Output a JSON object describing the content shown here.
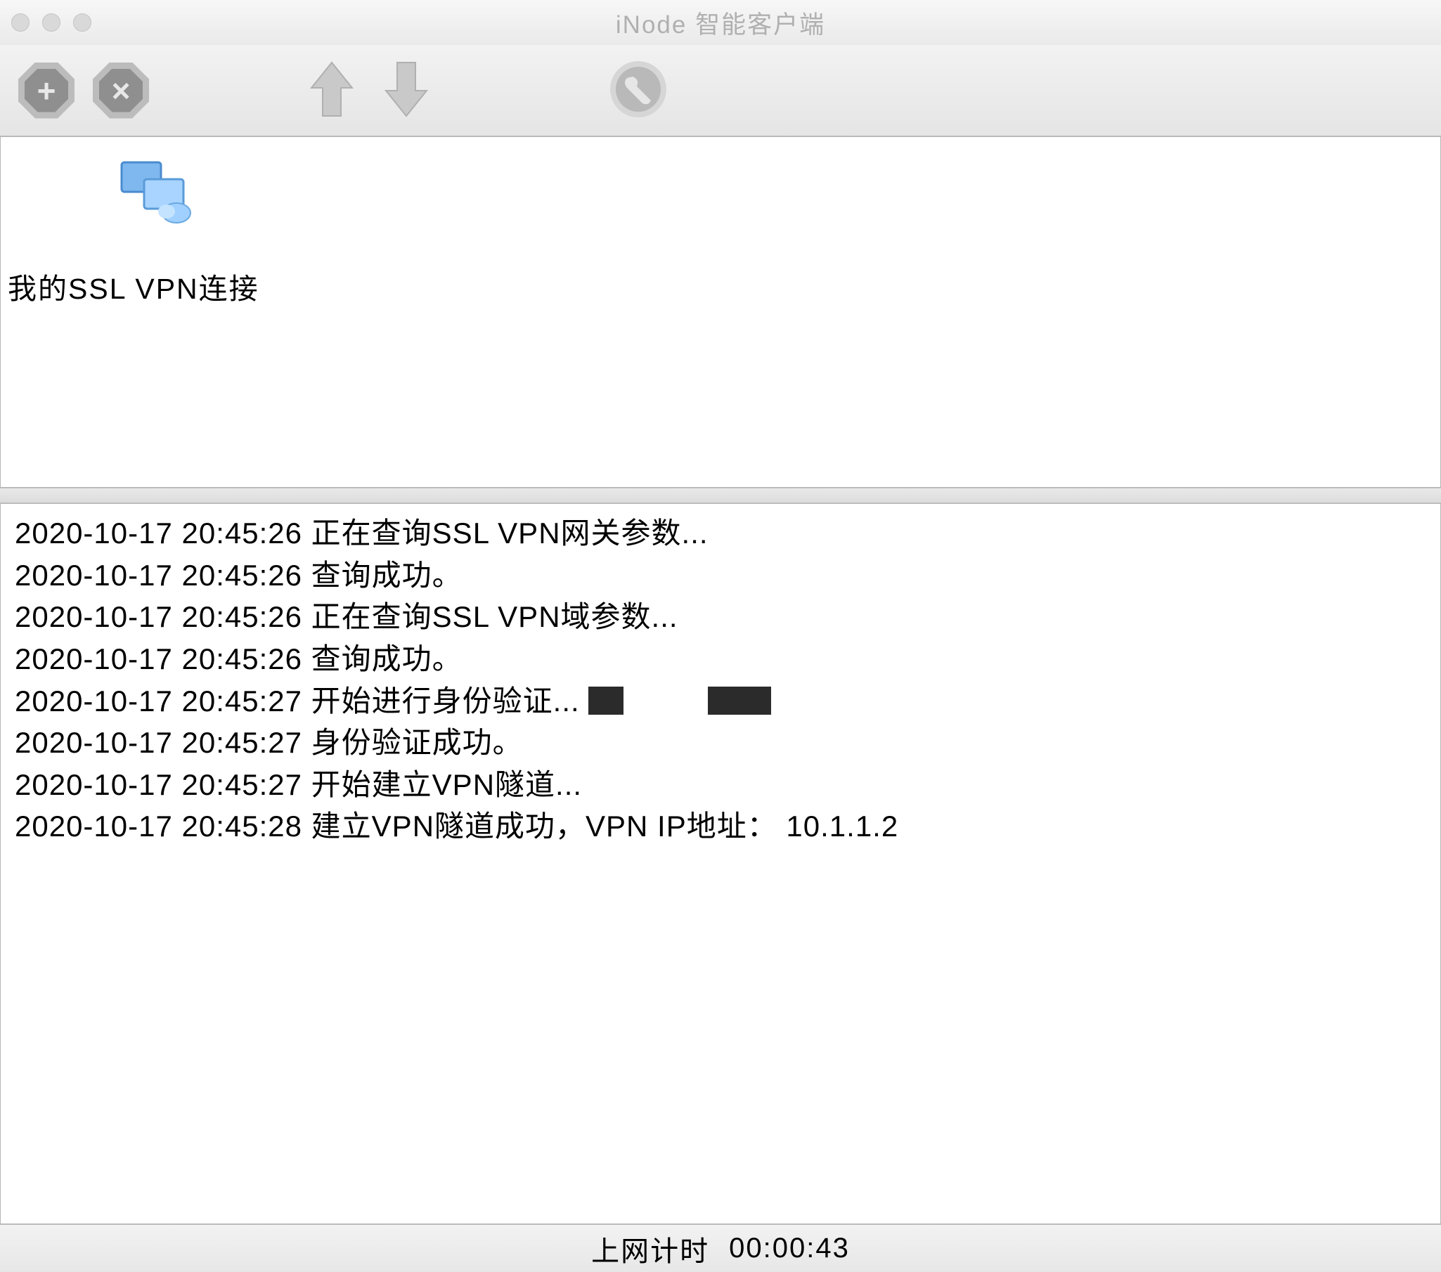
{
  "window": {
    "title": "iNode 智能客户端"
  },
  "toolbar": {
    "add_label": "add",
    "remove_label": "remove",
    "up_label": "up",
    "down_label": "down",
    "settings_label": "settings"
  },
  "connections": {
    "items": [
      {
        "label": "我的SSL VPN连接"
      }
    ]
  },
  "log": {
    "lines": [
      "2020-10-17 20:45:26 正在查询SSL VPN网关参数...",
      "2020-10-17 20:45:26 查询成功。",
      "2020-10-17 20:45:26 正在查询SSL VPN域参数...",
      "2020-10-17 20:45:26 查询成功。",
      "2020-10-17 20:45:27 开始进行身份验证...",
      "2020-10-17 20:45:27 身份验证成功。",
      "2020-10-17 20:45:27 开始建立VPN隧道...",
      "2020-10-17 20:45:28 建立VPN隧道成功，VPN IP地址： 10.1.1.2"
    ],
    "redacted_line_index": 4
  },
  "status": {
    "label": "上网计时",
    "time": "00:00:43"
  }
}
